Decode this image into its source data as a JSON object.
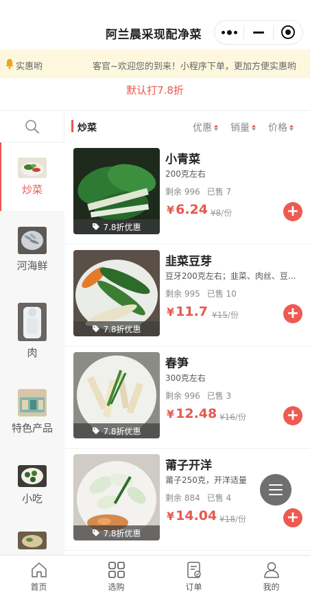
{
  "app": {
    "title": "阿兰晨采现配净菜"
  },
  "colors": {
    "accent": "#e8574e",
    "notice_bg": "#fdf7de"
  },
  "notice": {
    "left_text": "实惠哟",
    "right_text": "客官~欢迎您的到来！小程序下单，更加方便实惠哟"
  },
  "discount_banner": "默认打7.8折",
  "sidebar": {
    "categories": [
      {
        "label": "炒菜",
        "active": true
      },
      {
        "label": "河海鲜",
        "active": false
      },
      {
        "label": "肉",
        "active": false
      },
      {
        "label": "特色产品",
        "active": false
      },
      {
        "label": "小吃",
        "active": false
      }
    ]
  },
  "filter": {
    "current_category": "炒菜",
    "sort_options": [
      "优惠",
      "销量",
      "价格"
    ]
  },
  "products": [
    {
      "name": "小青菜",
      "spec": "200克左右",
      "stock_label": "剩余 996",
      "sold_label": "已售 7",
      "price": "6.24",
      "orig_price": "¥8",
      "unit": "/份",
      "tag": "7.8折优惠"
    },
    {
      "name": "韭菜豆芽",
      "spec": "豆牙200克左右；韭菜、肉丝、豆...",
      "stock_label": "剩余 995",
      "sold_label": "已售 10",
      "price": "11.7",
      "orig_price": "¥15",
      "unit": "/份",
      "tag": "7.8折优惠"
    },
    {
      "name": "春笋",
      "spec": "300克左右",
      "stock_label": "剩余 996",
      "sold_label": "已售 3",
      "price": "12.48",
      "orig_price": "¥16",
      "unit": "/份",
      "tag": "7.8折优惠"
    },
    {
      "name": "莆子开洋",
      "spec": "莆子250克，开洋适量",
      "stock_label": "剩余 884",
      "sold_label": "已售 4",
      "price": "14.04",
      "orig_price": "¥18",
      "unit": "/份",
      "tag": "7.8折优惠"
    }
  ],
  "currency": "¥",
  "tabbar": {
    "items": [
      {
        "label": "首页",
        "icon": "home-icon"
      },
      {
        "label": "选购",
        "icon": "grid-icon"
      },
      {
        "label": "订单",
        "icon": "order-icon"
      },
      {
        "label": "我的",
        "icon": "user-icon"
      }
    ]
  }
}
